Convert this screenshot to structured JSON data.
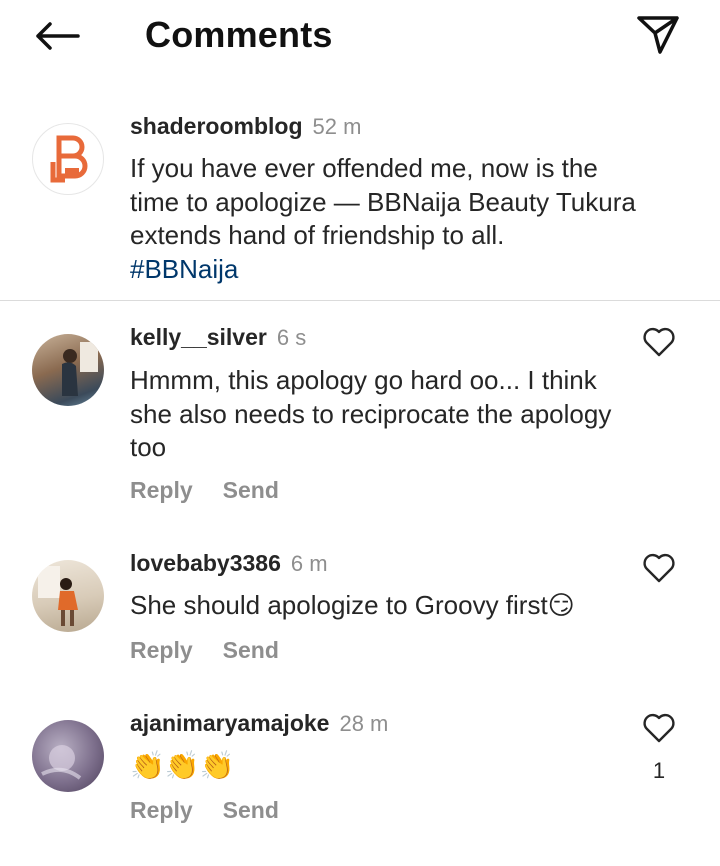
{
  "header": {
    "title": "Comments",
    "back_icon": "arrow-left-icon",
    "dm_icon": "paper-plane-icon"
  },
  "caption": {
    "username": "shaderoomblog",
    "time": "52 m",
    "text": "If you have ever offended me, now is the time to apologize — BBNaija Beauty Tukura extends hand of friendship to all.",
    "hashtag": "#BBNaija",
    "avatar_logo_color": "#e86a3a"
  },
  "comments": [
    {
      "username": "kelly__silver",
      "time": "6 s",
      "text": "Hmmm, this apology go hard oo... I think she also needs to reciprocate the apology too",
      "reply": "Reply",
      "send": "Send",
      "likes": ""
    },
    {
      "username": "lovebaby3386",
      "time": "6 m",
      "text": "She should apologize to Groovy first😏",
      "reply": "Reply",
      "send": "Send",
      "likes": ""
    },
    {
      "username": "ajanimaryamajoke",
      "time": "28 m",
      "text": "👏👏👏",
      "reply": "Reply",
      "send": "Send",
      "likes": "1"
    }
  ],
  "colors": {
    "text": "#262626",
    "muted": "#8e8e8e",
    "hashtag": "#00376b",
    "divider": "#dbdbdb"
  }
}
